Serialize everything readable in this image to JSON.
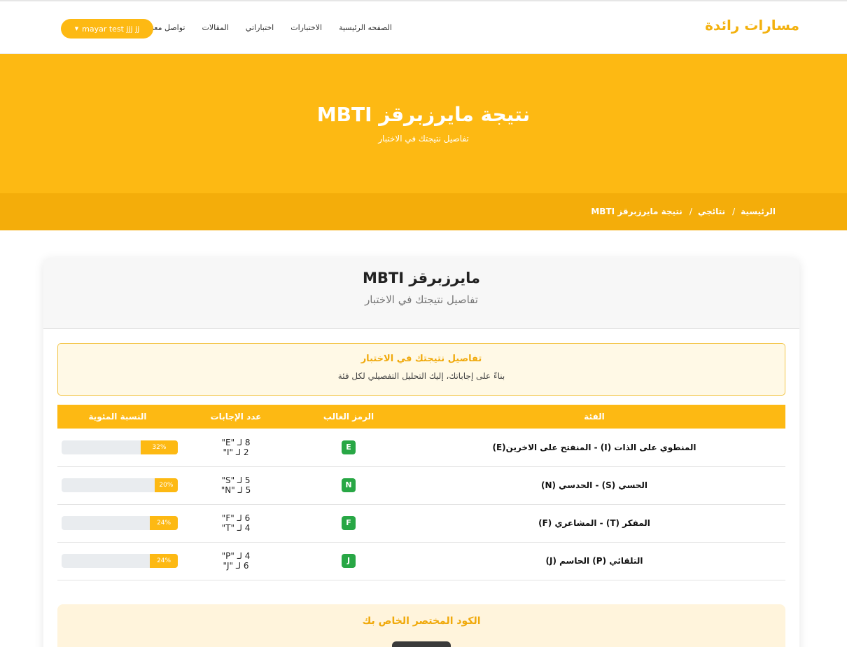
{
  "nav": {
    "brand": "مسارات رائدة",
    "links": [
      "الصفحه الرئيسية",
      "الاختبارات",
      "اختباراتي",
      "المقالات",
      "تواصل معنا"
    ],
    "user_label": "mayar test jjj jj"
  },
  "hero": {
    "title": "نتيجة مايرزبرقز MBTI",
    "subtitle": "تفاصيل نتيجتك في الاختبار"
  },
  "breadcrumb": [
    "الرئيسية",
    "نتائجي",
    "نتيجة مايرزبرقز MBTI"
  ],
  "card": {
    "title": "مايرزبرقز MBTI",
    "subtitle": "تفاصيل نتيجتك في الاختبار",
    "alert_title": "تفاصيل نتيجتك في الاختبار",
    "alert_text": "بناءً على إجاباتك، إليك التحليل التفصيلي لكل فئة",
    "code_title": "الكود المختصر الخاص بك"
  },
  "table": {
    "headers": [
      "الفئة",
      "الرمز الغالب",
      "عدد الإجابات",
      "النسبة المئوية"
    ],
    "rows": [
      {
        "category": "المنطوي على الذات (I) - المنفتح على الاخرين(E)",
        "dominant": "E",
        "count_line1": "8 لـ \"E\"",
        "count_line2": "2 لـ \"I\"",
        "percent": 32,
        "percent_label": "32%"
      },
      {
        "category": "الحسي (S) - الحدسي (N)",
        "dominant": "N",
        "count_line1": "5 لـ \"S\"",
        "count_line2": "5 لـ \"N\"",
        "percent": 20,
        "percent_label": "20%"
      },
      {
        "category": "المفكر (T) - المشاعري (F)",
        "dominant": "F",
        "count_line1": "6 لـ \"F\"",
        "count_line2": "4 لـ \"T\"",
        "percent": 24,
        "percent_label": "24%"
      },
      {
        "category": "التلقائي (P) الحاسم (J)",
        "dominant": "J",
        "count_line1": "4 لـ \"P\"",
        "count_line2": "6 لـ \"J\"",
        "percent": 24,
        "percent_label": "24%"
      }
    ]
  },
  "colors": {
    "accent": "#fdb913",
    "accent_dark": "#f4ad0a",
    "success": "#28a745"
  }
}
